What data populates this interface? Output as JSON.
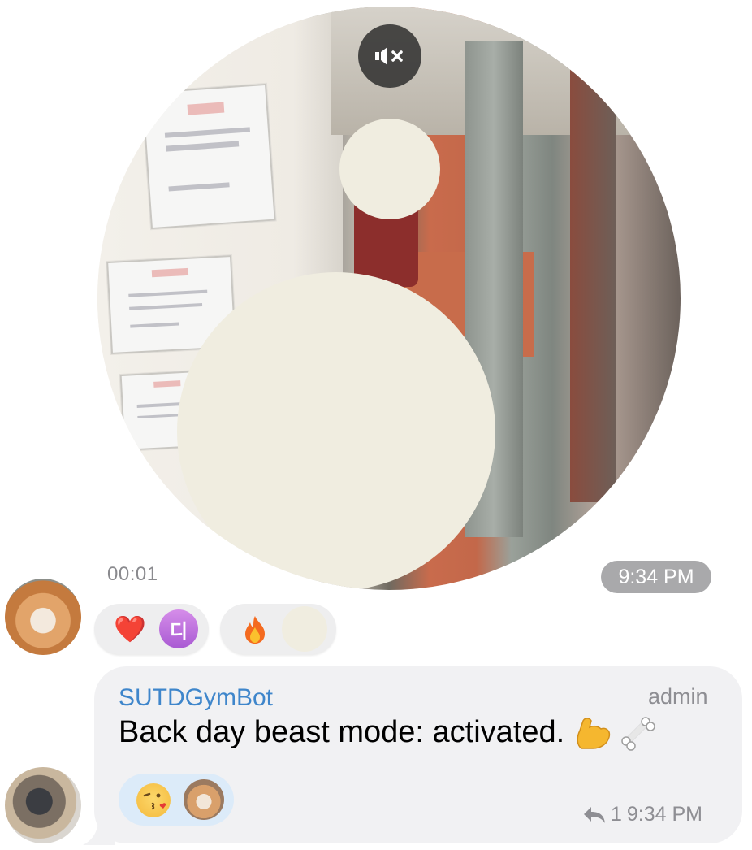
{
  "video_message": {
    "duration": "00:01",
    "time": "9:34 PM",
    "mute_icon": "speaker-muted-icon"
  },
  "reactions": [
    {
      "emoji": "❤️",
      "icon": "heart-icon",
      "avatar_letter": "디"
    },
    {
      "emoji": "🔥",
      "icon": "fire-icon"
    }
  ],
  "message": {
    "sender": "SUTDGymBot",
    "role": "admin",
    "text": "Back day beast mode: activated.",
    "text_emojis": [
      "flexed-biceps-icon",
      "bone-icon"
    ],
    "reaction_emoji": "kissing-heart-icon",
    "reply_count": "1",
    "time": "9:34 PM"
  },
  "colors": {
    "sender_name": "#3f86cb",
    "bubble_bg": "#f1f1f3",
    "reaction_bg": "#eeeeef",
    "message_reaction_bg": "#dcebf9",
    "time_pill_bg": "#a9a9ab"
  }
}
